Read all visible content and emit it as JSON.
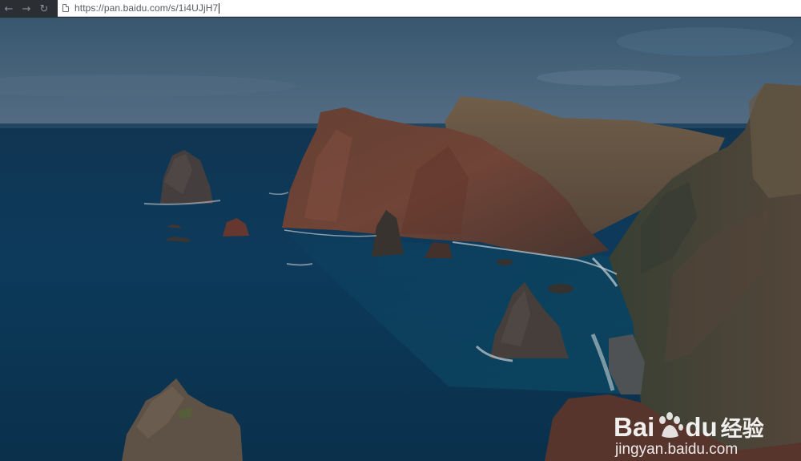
{
  "browser": {
    "back_icon": "arrow-left-icon",
    "forward_icon": "arrow-right-icon",
    "reload_icon": "reload-icon",
    "page_icon": "document-icon",
    "url": "https://pan.baidu.com/s/1i4UJjH7"
  },
  "watermark": {
    "logo_text_left": "Bai",
    "logo_text_right": "du",
    "logo_cn": "经验",
    "url": "jingyan.baidu.com"
  }
}
